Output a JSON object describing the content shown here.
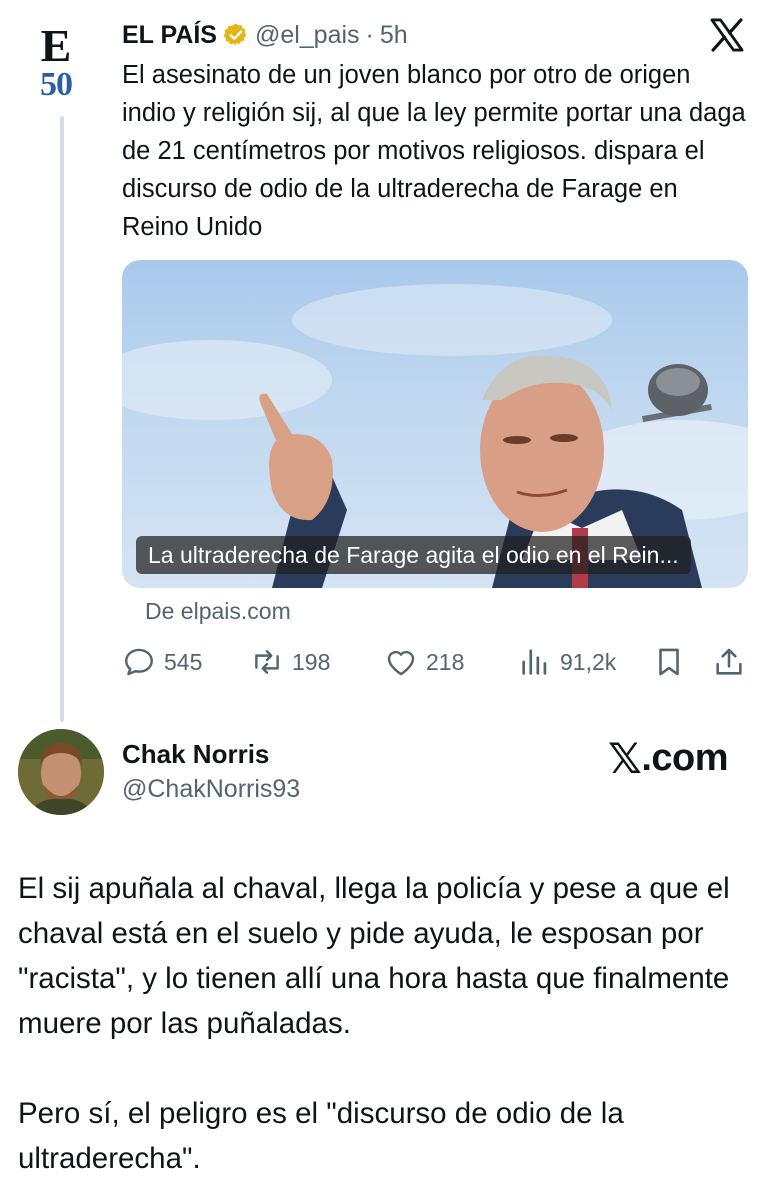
{
  "quoted_tweet": {
    "logo": {
      "letter": "E",
      "number": "50",
      "accent": "#2a5fa8"
    },
    "author_name": "EL PAÍS",
    "verified_color": "#e2b719",
    "handle": "@el_pais",
    "separator": "·",
    "time": "5h",
    "text": "El asesinato de un joven blanco por otro de origen indio y religión sij, al que la ley permite portar una daga de 21 centímetros por motivos religiosos. dispara el discurso de odio de la ultraderecha de Farage en Reino Unido",
    "card": {
      "caption": "La ultraderecha de Farage agita el odio en el Rein...",
      "source": "De elpais.com"
    },
    "actions": {
      "replies": "545",
      "reposts": "198",
      "likes": "218",
      "views": "91,2k"
    }
  },
  "quoting_tweet": {
    "author_name": "Chak Norris",
    "handle": "@ChakNorris93",
    "site_badge": ".com",
    "paragraphs": [
      "El sij apuñala al chaval, llega la policía y pese a que el chaval está en el suelo y pide ayuda, le esposan por \"racista\", y lo tienen allí una hora hasta que finalmente muere por las puñaladas.",
      "Pero sí, el peligro es el \"discurso de odio de la ultraderecha\"."
    ]
  },
  "colors": {
    "text": "#0f1419",
    "muted": "#536471",
    "line": "#d7dce0"
  }
}
